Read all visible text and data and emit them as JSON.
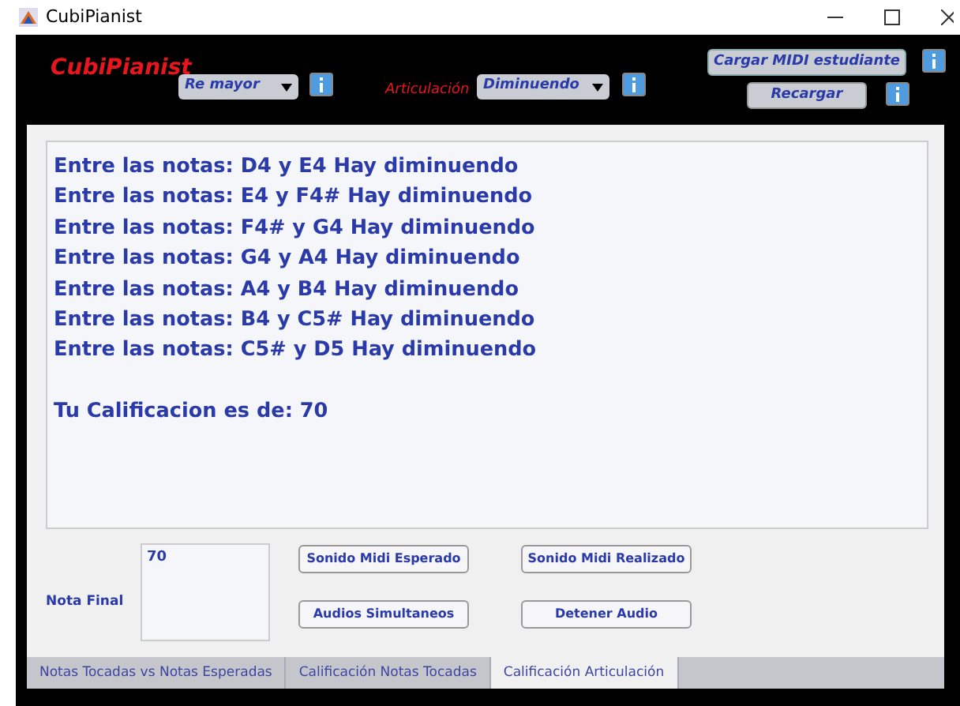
{
  "window": {
    "title": "CubiPianist"
  },
  "header": {
    "app_title": "CubiPianist",
    "key_select": {
      "value": "Re mayor"
    },
    "articulation_label": "Articulación",
    "articulation_select": {
      "value": "Diminuendo"
    },
    "load_button": "Cargar MIDI estudiante",
    "reload_button": "Recargar"
  },
  "results": {
    "lines": [
      "Entre las notas: D4 y E4 Hay diminuendo",
      "Entre las notas: E4 y F4# Hay diminuendo",
      "Entre las notas: F4# y G4 Hay diminuendo",
      "Entre las notas: G4 y A4 Hay diminuendo",
      "Entre las notas: A4 y B4 Hay diminuendo",
      "Entre las notas: B4 y C5# Hay diminuendo",
      "Entre las notas: C5# y D5 Hay diminuendo"
    ],
    "grade": "Tu Calificacion es de: 70"
  },
  "final": {
    "label": "Nota Final",
    "value": "70"
  },
  "buttons": [
    "Sonido Midi Esperado",
    "Sonido Midi Realizado",
    "Audios Simultaneos",
    "Detener Audio"
  ],
  "tabs": [
    {
      "label": "Notas Tocadas vs Notas Esperadas",
      "selected": false
    },
    {
      "label": "Calificación Notas Tocadas",
      "selected": false
    },
    {
      "label": "Calificación Articulación",
      "selected": true
    }
  ]
}
